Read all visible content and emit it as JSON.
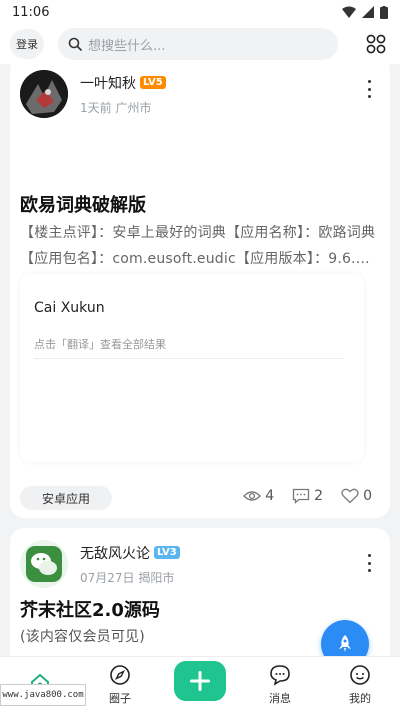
{
  "status": {
    "time": "11:06"
  },
  "topbar": {
    "login_label": "登录",
    "search_placeholder": "想搜些什么..."
  },
  "posts": [
    {
      "author": "一叶知秋",
      "level": "LV5",
      "level_color": "#ff8a00",
      "meta": "1天前 广州市",
      "title": "欧易词典破解版",
      "excerpt": "【楼主点评】：安卓上最好的词典【应用名称】：欧路词典【应用包名】：com.eusoft.eudic【应用版本】：9.6....",
      "embed": {
        "text": "Cai Xukun",
        "hint": "点击「翻译」查看全部结果"
      },
      "tag": "安卓应用",
      "views": "4",
      "comments": "2",
      "likes": "0"
    },
    {
      "author": "无敌风火论",
      "level": "LV3",
      "level_color": "#5bb6f0",
      "meta": "07月27日 揭阳市",
      "title": "芥末社区2.0源码",
      "excerpt": "(该内容仅会员可见)"
    }
  ],
  "nav": {
    "home": "",
    "circle": "圈子",
    "messages": "消息",
    "mine": "我的"
  },
  "watermark": "www.java800.com"
}
